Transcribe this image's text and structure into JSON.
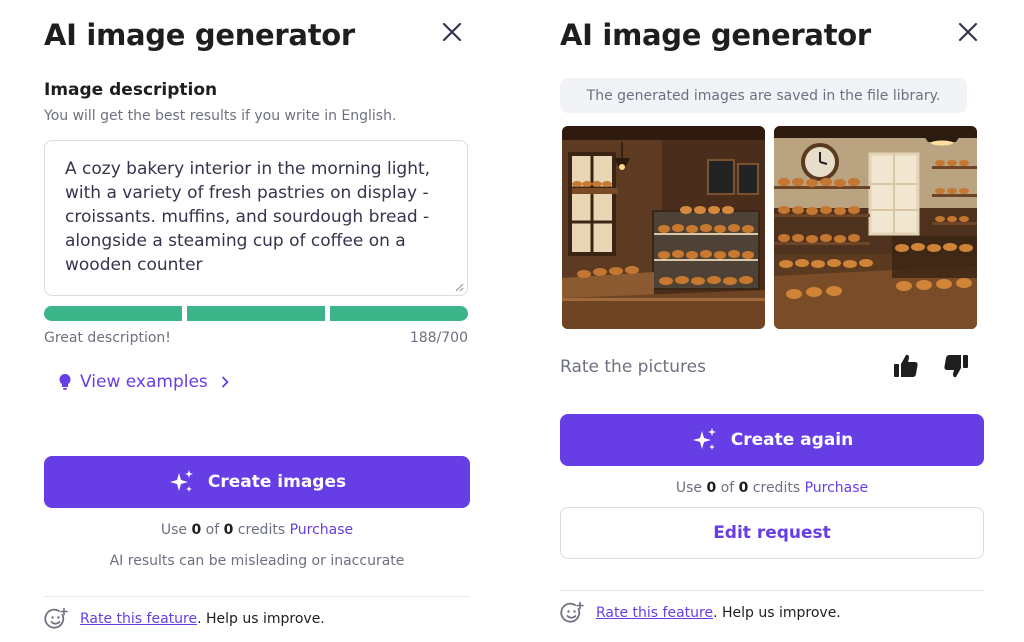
{
  "left_panel": {
    "title": "AI image generator",
    "description_label": "Image description",
    "description_hint": "You will get the best results if you write in English.",
    "description_value": "A cozy bakery interior in the morning light, with a variety of fresh pastries on display - croissants. muffins, and sourdough bread - alongside a steaming cup of coffee on a wooden counter",
    "quality_meter": {
      "segments_filled": 3,
      "segments_total": 3,
      "color": "#3db58b"
    },
    "quality_text": "Great description!",
    "char_count": "188/700",
    "view_examples_label": "View examples",
    "create_button_label": "Create images",
    "credits": {
      "prefix": "Use",
      "used": "0",
      "of_word": "of",
      "total": "0",
      "suffix": "credits",
      "purchase_label": "Purchase"
    },
    "disclaimer": "AI results can be misleading or inaccurate",
    "feedback": {
      "link_label": "Rate this feature",
      "suffix": ". Help us improve."
    }
  },
  "right_panel": {
    "title": "AI image generator",
    "notice": "The generated images are saved in the file library.",
    "rate_label": "Rate the pictures",
    "create_again_label": "Create again",
    "credits": {
      "prefix": "Use",
      "used": "0",
      "of_word": "of",
      "total": "0",
      "suffix": "credits",
      "purchase_label": "Purchase"
    },
    "edit_request_label": "Edit request",
    "feedback": {
      "link_label": "Rate this feature",
      "suffix": ". Help us improve."
    }
  },
  "icons": {
    "close": "close-icon",
    "sparkles": "sparkles-icon",
    "lightbulb": "lightbulb-icon",
    "chevron": "chevron-right-icon",
    "thumbs_up": "thumbs-up-icon",
    "thumbs_down": "thumbs-down-icon",
    "smiley": "smiley-plus-icon"
  },
  "colors": {
    "accent": "#673de6",
    "success": "#3db58b",
    "text_primary": "#1d1e20",
    "text_muted": "#6d7081"
  }
}
